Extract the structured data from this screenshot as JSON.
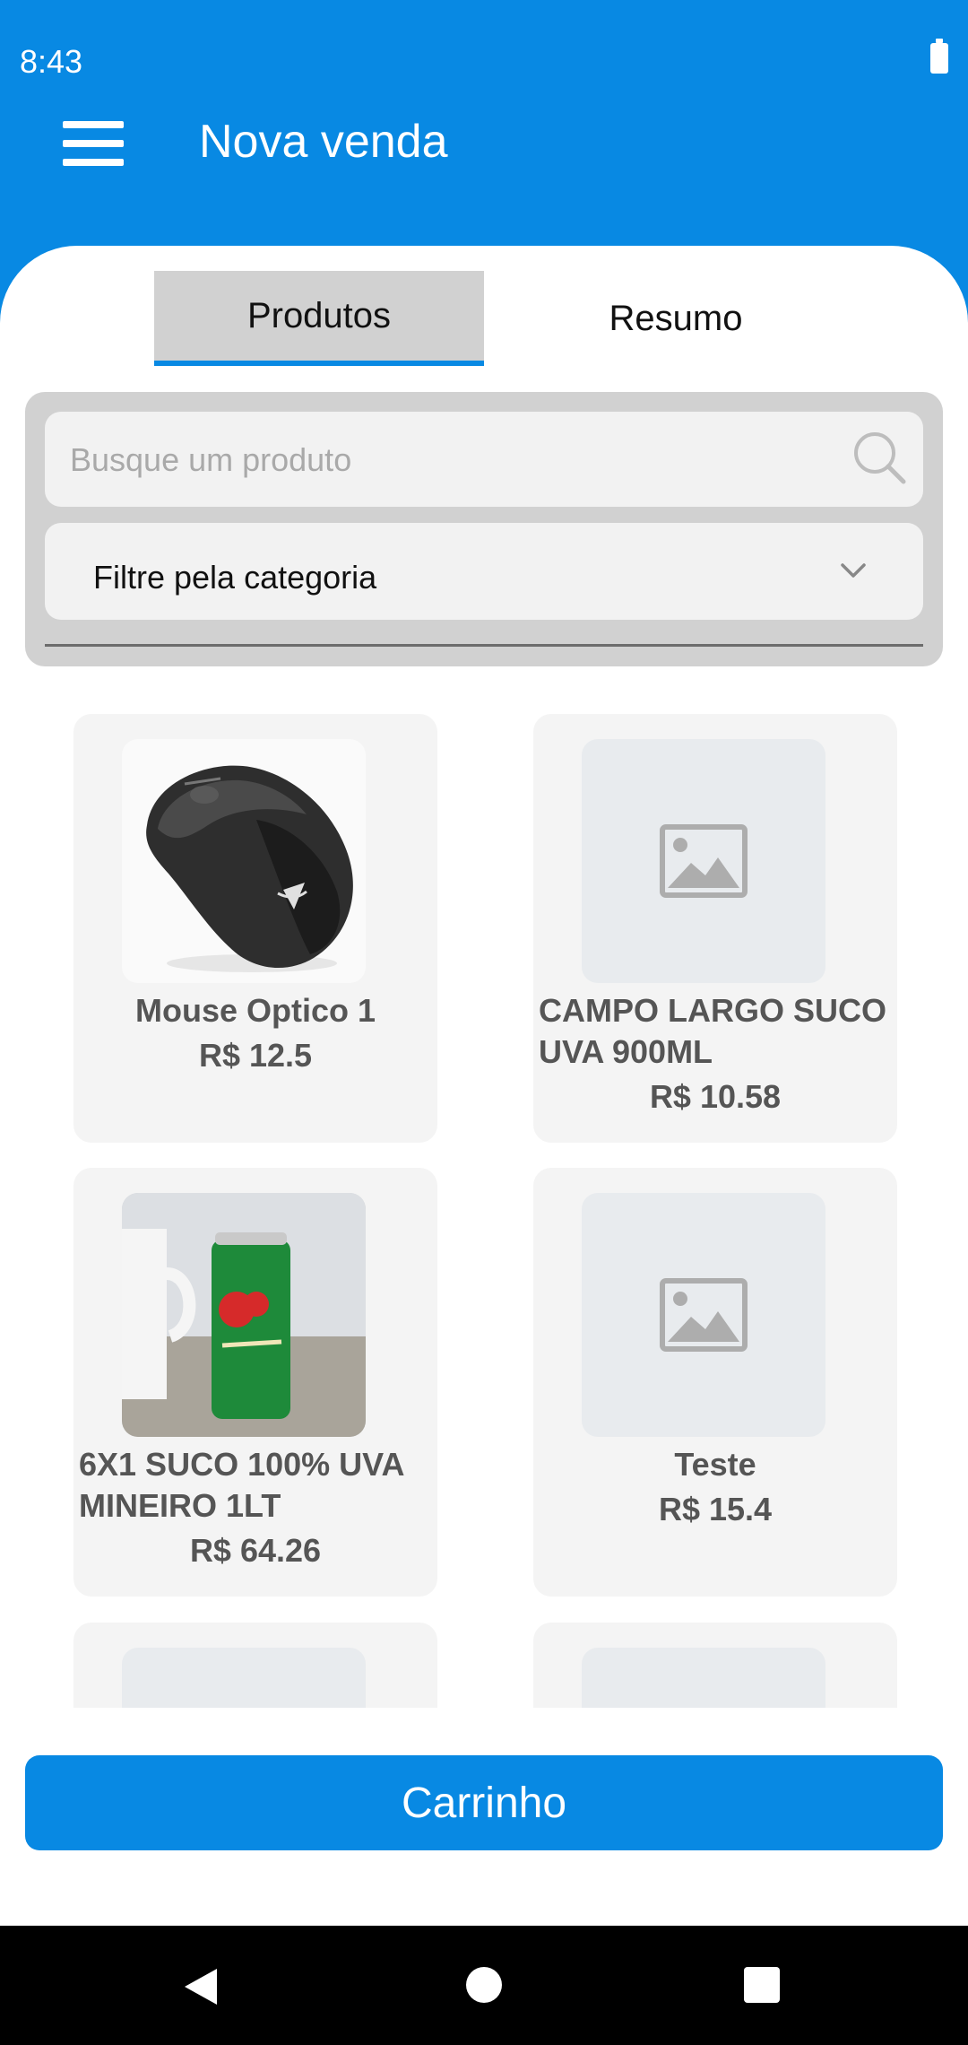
{
  "status": {
    "time": "8:43"
  },
  "appbar": {
    "title": "Nova venda"
  },
  "tabs": [
    {
      "label": "Produtos",
      "active": true
    },
    {
      "label": "Resumo",
      "active": false
    }
  ],
  "search": {
    "placeholder": "Busque um produto",
    "value": ""
  },
  "category": {
    "label": "Filtre pela categoria"
  },
  "products": [
    {
      "name": "Mouse Optico 1",
      "price": "R$ 12.5",
      "image": "mouse-photo"
    },
    {
      "name": "CAMPO LARGO SUCO UVA 900ML",
      "price": "R$ 10.58",
      "image": "image-placeholder-icon"
    },
    {
      "name": "6X1 SUCO 100% UVA MINEIRO 1LT",
      "price": "R$ 64.26",
      "image": "soda-can-photo"
    },
    {
      "name": "Teste",
      "price": "R$ 15.4",
      "image": "image-placeholder-icon"
    }
  ],
  "cart": {
    "label": "Carrinho"
  },
  "colors": {
    "primary": "#0889E3",
    "tab_active_bg": "#D1D1D1",
    "card_bg": "#F4F4F4",
    "text_muted": "#555555"
  }
}
